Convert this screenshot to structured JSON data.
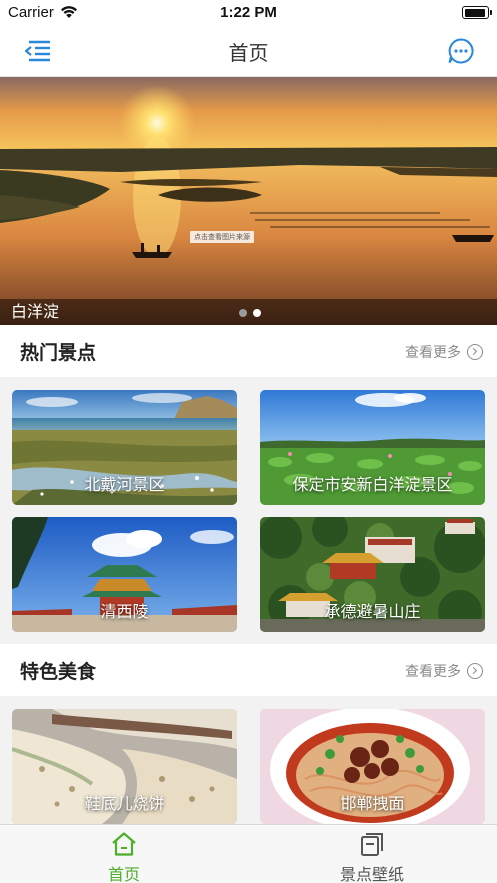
{
  "status_bar": {
    "carrier": "Carrier",
    "time": "1:22 PM"
  },
  "nav": {
    "title": "首页",
    "left_icon": "menu-indent-icon",
    "right_icon": "message-bubble-icon"
  },
  "banner": {
    "caption": "白洋淀",
    "source_tag": "点击查看图片来源",
    "page_count": 2,
    "active_page": 2
  },
  "sections": [
    {
      "title": "热门景点",
      "more_label": "查看更多",
      "items": [
        {
          "label": "北戴河景区"
        },
        {
          "label": "保定市安新白洋淀景区"
        },
        {
          "label": "清西陵"
        },
        {
          "label": "承德避暑山庄"
        }
      ]
    },
    {
      "title": "特色美食",
      "more_label": "查看更多",
      "items": [
        {
          "label": "鞋底儿烧饼"
        },
        {
          "label": "邯郸拽面"
        }
      ]
    }
  ],
  "tab_bar": {
    "tabs": [
      {
        "label": "首页",
        "icon": "home-icon",
        "active": true
      },
      {
        "label": "景点壁纸",
        "icon": "wallpaper-icon",
        "active": false
      }
    ]
  },
  "colors": {
    "accent": "#4caf2a",
    "nav_icon": "#2b87d9",
    "tab_inactive": "#555555"
  }
}
